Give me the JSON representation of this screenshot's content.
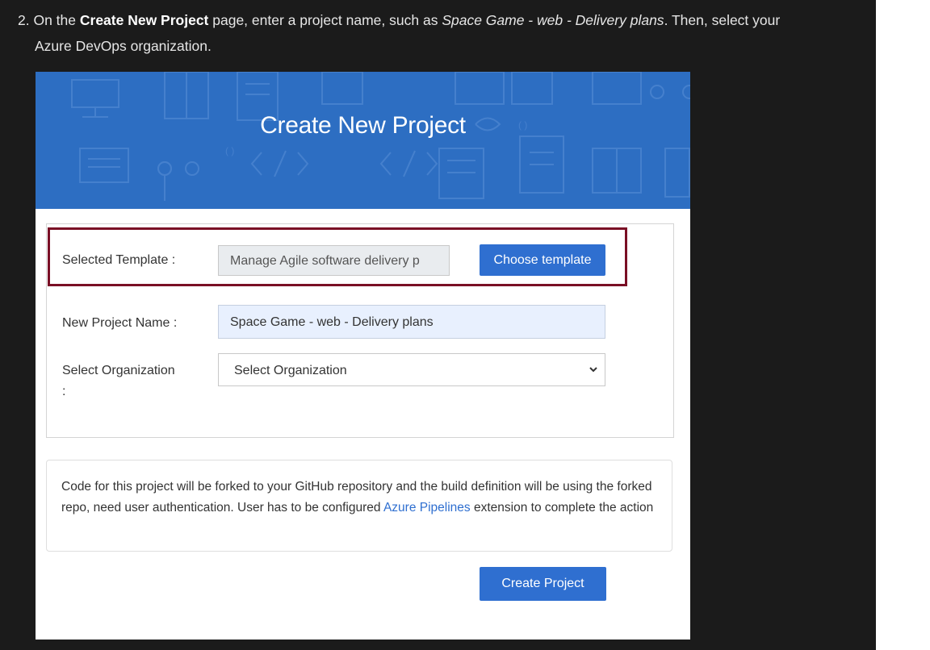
{
  "step": {
    "number": "2.",
    "part1": " On the ",
    "bold": "Create New Project",
    "part2": " page, enter a project name, such as ",
    "italic": "Space Game - web - Delivery plans",
    "part3": ". Then, select your",
    "line2": "Azure DevOps organization."
  },
  "screenshot": {
    "banner_title": "Create New Project",
    "selected_template_label": "Selected Template :",
    "selected_template_value": "Manage Agile software delivery p",
    "choose_template_button": "Choose template",
    "project_name_label": "New Project Name :",
    "project_name_value": "Space Game - web - Delivery plans",
    "organization_label_line1": "Select Organization",
    "organization_label_line2": ":",
    "organization_select_value": "Select Organization",
    "info_text": "Code for this project will be forked to your GitHub repository and the build definition will be using the forked repo, need user authentication. User has to be configured ",
    "info_link": "Azure Pipelines",
    "info_text_end": " extension to complete the action",
    "create_project_button": "Create Project"
  },
  "colors": {
    "banner": "#2d6ec2",
    "button": "#2f6fd0",
    "highlight_border": "#7a0f25",
    "page_background": "#1b1b1b"
  },
  "icons": [
    "chevron-down-icon",
    "banner-pattern-icons"
  ]
}
